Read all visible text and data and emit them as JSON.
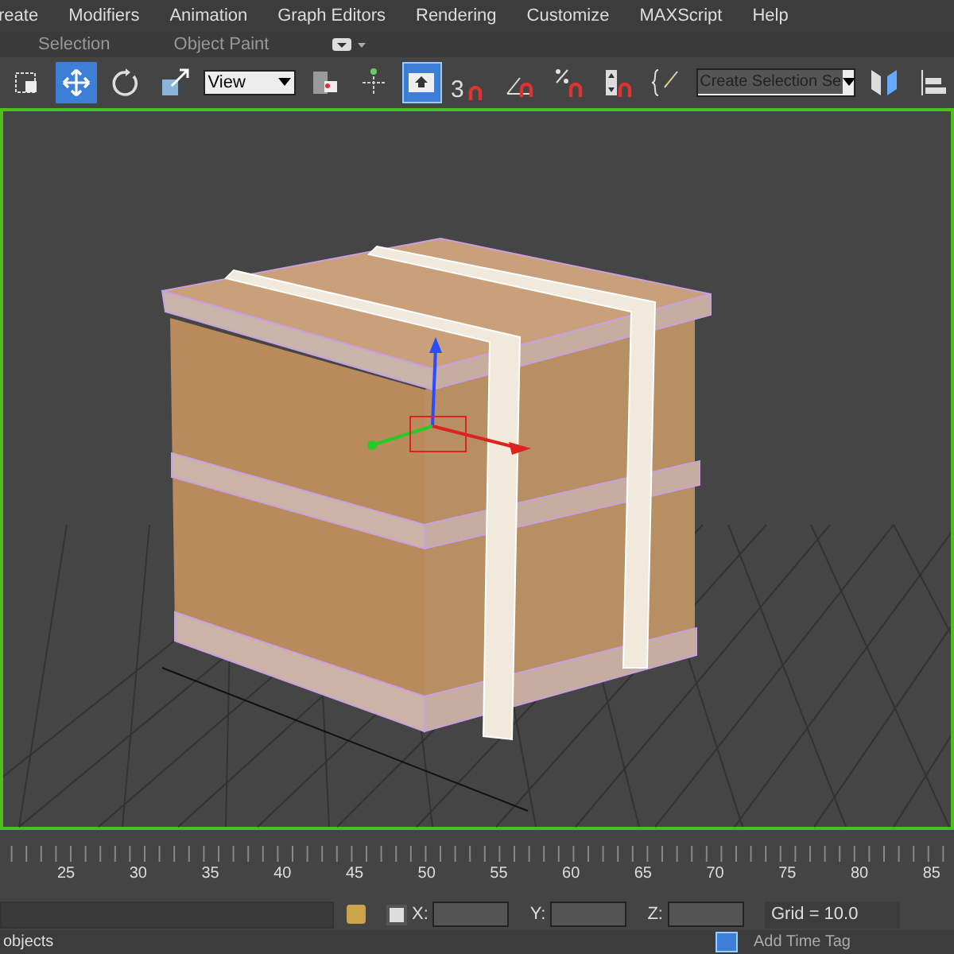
{
  "menu": [
    "reate",
    "Modifiers",
    "Animation",
    "Graph Editors",
    "Rendering",
    "Customize",
    "MAXScript",
    "Help"
  ],
  "ribbon_tabs": [
    {
      "label": "Selection",
      "selected": false
    },
    {
      "label": "Object Paint",
      "selected": false
    }
  ],
  "toolbar": {
    "tools": [
      {
        "kind": "select",
        "selected": false
      },
      {
        "kind": "move",
        "selected": true
      },
      {
        "kind": "rotate",
        "selected": false
      },
      {
        "kind": "scale",
        "selected": false
      }
    ],
    "reference_coordinate": "View",
    "snap_label": "3",
    "selection_set_placeholder": "Create Selection Se",
    "manipulate_selected": true
  },
  "timeline": {
    "ticks": [
      "25",
      "30",
      "35",
      "40",
      "45",
      "50",
      "55",
      "60",
      "65",
      "70",
      "75",
      "80",
      "85"
    ]
  },
  "status": {
    "x_label": "X:",
    "y_label": "Y:",
    "z_label": "Z:",
    "grid": "Grid = 10.0",
    "prompt": "objects",
    "time_tag": "Add Time Tag"
  }
}
